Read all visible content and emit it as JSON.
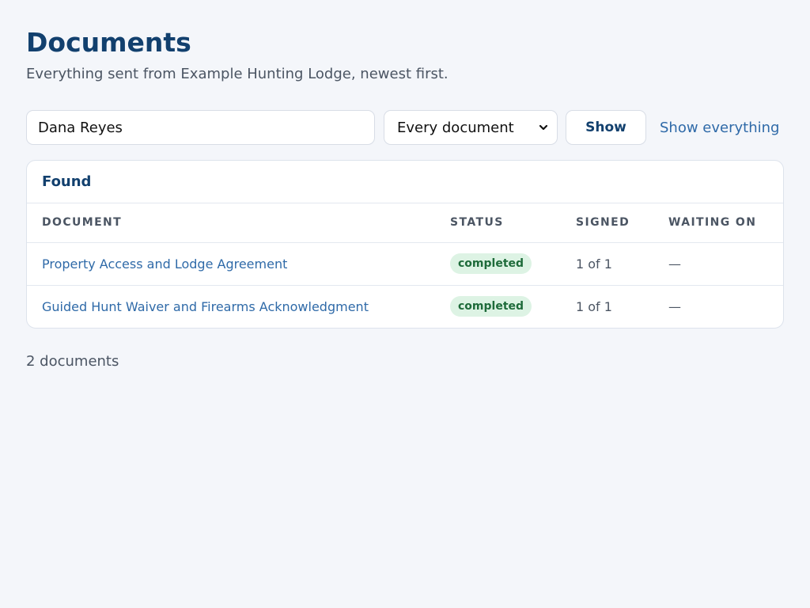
{
  "header": {
    "title": "Documents",
    "subtitle": "Everything sent from Example Hunting Lodge, newest first."
  },
  "filters": {
    "search_value": "Dana Reyes",
    "select_value": "Every document",
    "show_label": "Show",
    "show_all_label": "Show everything"
  },
  "results": {
    "heading": "Found",
    "columns": [
      "DOCUMENT",
      "STATUS",
      "SIGNED",
      "WAITING ON"
    ],
    "rows": [
      {
        "document": "Property Access and Lodge Agreement",
        "status": "completed",
        "signed": "1 of 1",
        "waiting_on": "—"
      },
      {
        "document": "Guided Hunt Waiver and Firearms Acknowledgment",
        "status": "completed",
        "signed": "1 of 1",
        "waiting_on": "—"
      }
    ],
    "count_text": "2 documents"
  },
  "icons": {
    "select_arrow": "chevron-down-icon"
  },
  "colors": {
    "title": "#12406e",
    "link": "#2f6aa8",
    "badge_bg": "#ddf3e4",
    "badge_text": "#1e6b3a",
    "background": "#f4f6fa"
  }
}
